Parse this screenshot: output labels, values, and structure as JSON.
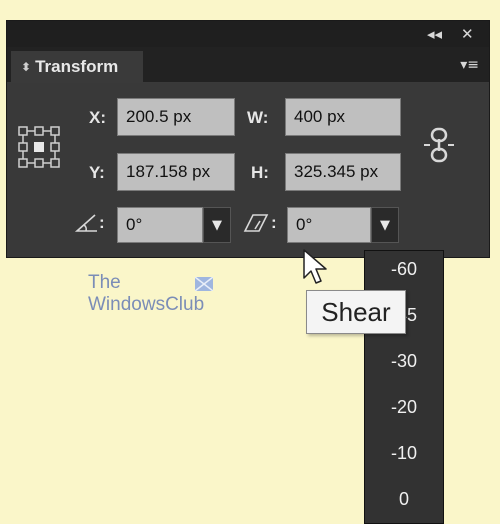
{
  "panel": {
    "title": "Transform",
    "collapse_glyph": "◂◂",
    "close_glyph": "✕",
    "menu_glyph": "▾≡"
  },
  "fields": {
    "x": {
      "label": "X:",
      "value": "200.5 px"
    },
    "y": {
      "label": "Y:",
      "value": "187.158 px"
    },
    "w": {
      "label": "W:",
      "value": "400 px"
    },
    "h": {
      "label": "H:",
      "value": "325.345 px"
    },
    "rotate": {
      "label": ":",
      "value": "0°"
    },
    "shear": {
      "label": ":",
      "value": "0°"
    }
  },
  "shear_dropdown": {
    "options": [
      "-60",
      "-45",
      "-30",
      "-20",
      "-10",
      "0"
    ]
  },
  "tooltip": "Shear",
  "watermark": {
    "line1": "The",
    "line2": "WindowsClub"
  },
  "colors": {
    "background": "#faf6c9",
    "panel": "#393939",
    "field": "#bfbfbf",
    "watermark": "#7b8db7"
  }
}
